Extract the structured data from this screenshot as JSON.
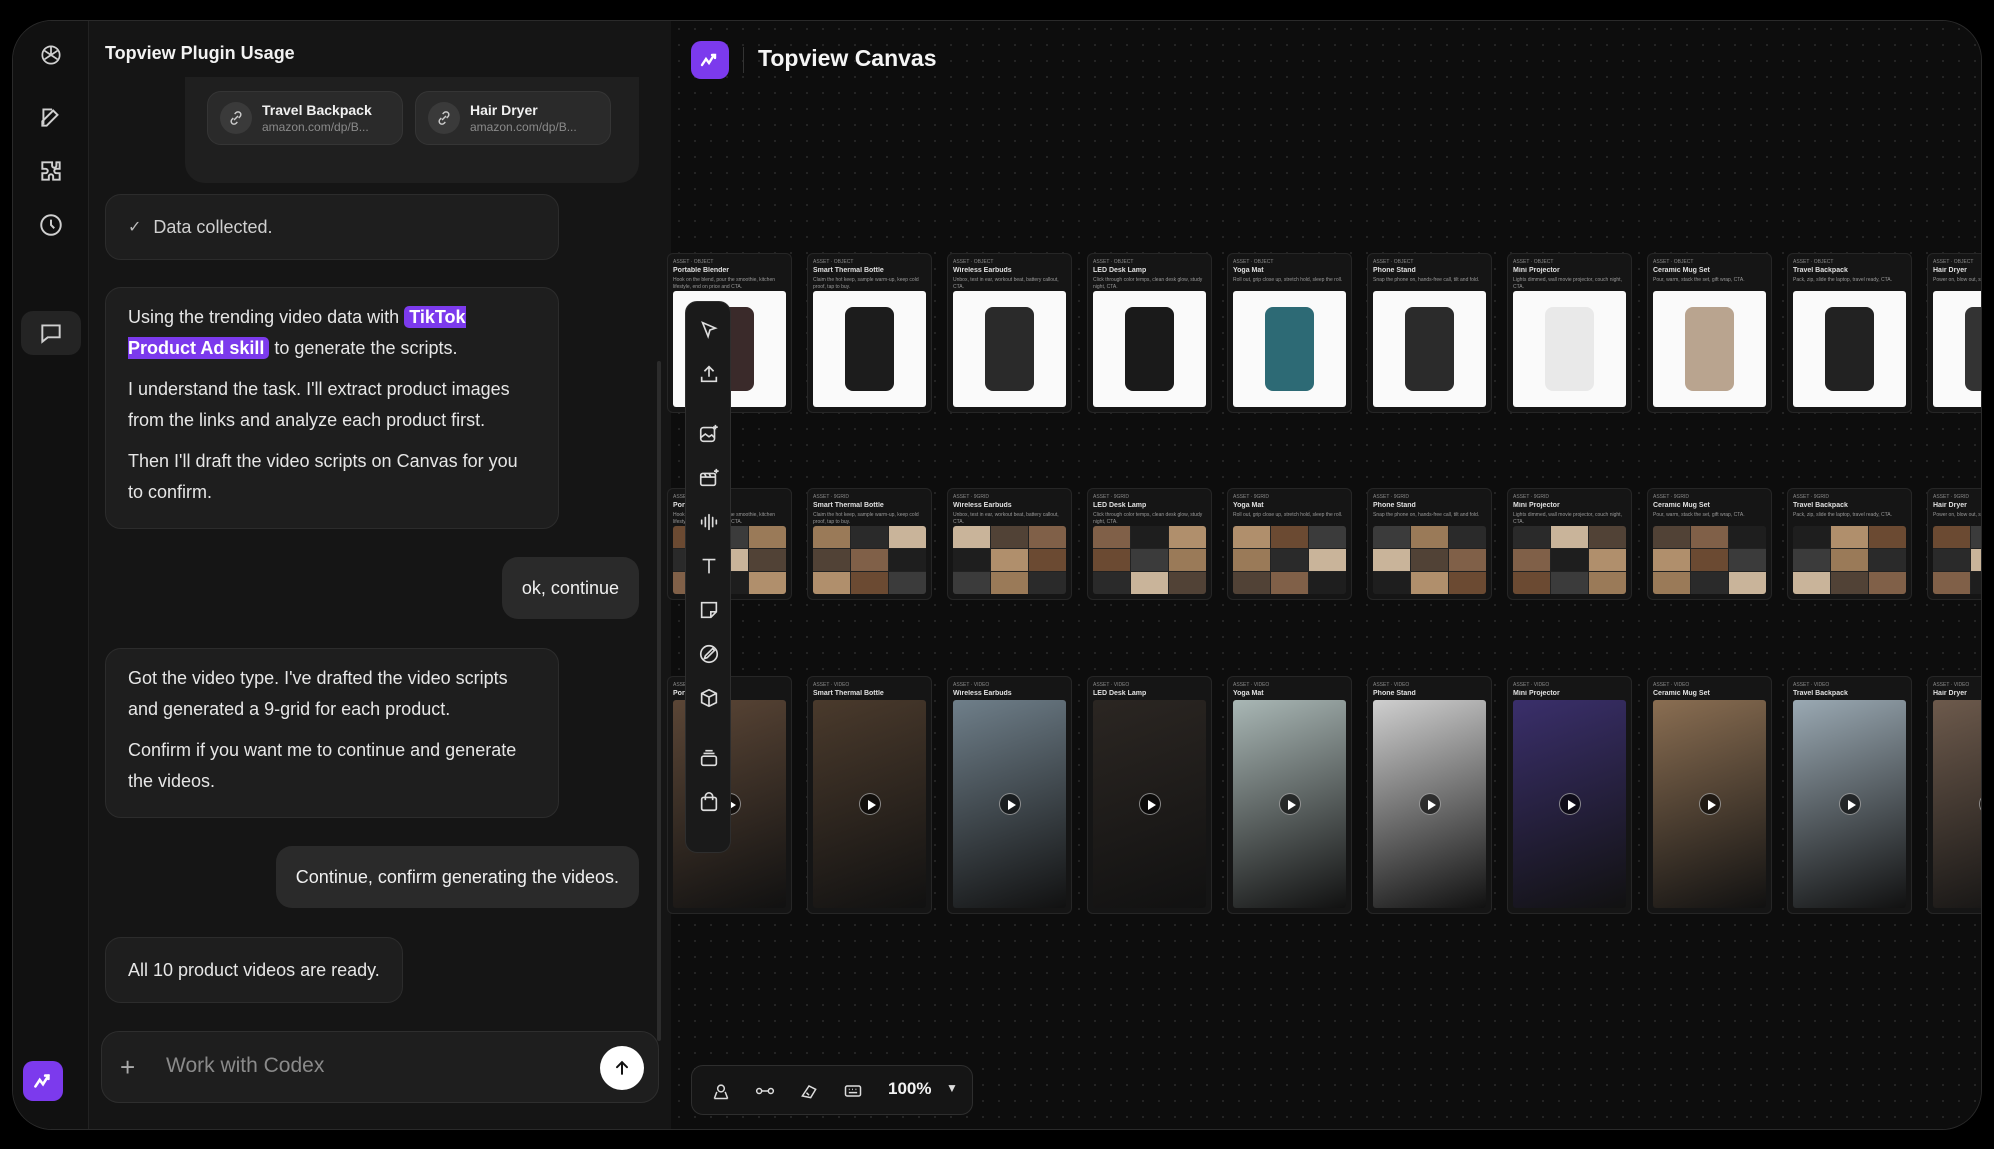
{
  "chat": {
    "title": "Topview Plugin Usage",
    "attachments": [
      {
        "name": "Travel Backpack",
        "url": "amazon.com/dp/B..."
      },
      {
        "name": "Hair Dryer",
        "url": "amazon.com/dp/B..."
      }
    ],
    "status": "Data collected.",
    "msg1": {
      "prefix": "Using the trending video data with",
      "skill": "TikTok Product Ad skill",
      "suffix": "to generate the scripts.",
      "p2": "I understand the task. I'll extract product images from the links and analyze each product first.",
      "p3": "Then I'll draft the video scripts on Canvas for you to confirm."
    },
    "user1": "ok, continue",
    "msg2": {
      "p1": "Got the video type. I've drafted the video scripts and generated a 9-grid for each product.",
      "p2": "Confirm if you want me to continue and generate the videos."
    },
    "user2": "Continue, confirm generating the videos.",
    "msg3": "All 10 product videos are ready.",
    "composer_placeholder": "Work with Codex"
  },
  "canvas": {
    "title": "Topview Canvas",
    "zoom": "100%",
    "products": [
      {
        "name": "Portable Blender",
        "desc": "Hook on the blend, pour the smoothie, kitchen lifestyle, end on price and CTA.",
        "color": "#3a2a2a"
      },
      {
        "name": "Smart Thermal Bottle",
        "desc": "Claim the hot keep, sample warm-up, keep cold proof, tap to buy.",
        "color": "#1c1c1c"
      },
      {
        "name": "Wireless Earbuds",
        "desc": "Unbox, test in ear, workout beat, battery callout, CTA.",
        "color": "#2a2a2a"
      },
      {
        "name": "LED Desk Lamp",
        "desc": "Click through color temps, clean desk glow, study night, CTA.",
        "color": "#1a1a1a"
      },
      {
        "name": "Yoga Mat",
        "desc": "Roll out, grip close up, stretch hold, sleep the roll.",
        "color": "#2d6a75"
      },
      {
        "name": "Phone Stand",
        "desc": "Snap the phone on, hands-free call, tilt and fold.",
        "color": "#2b2b2b"
      },
      {
        "name": "Mini Projector",
        "desc": "Lights dimmed, wall movie projector, couch night, CTA.",
        "color": "#e9e9e9"
      },
      {
        "name": "Ceramic Mug Set",
        "desc": "Pour, warm, stack the set, gift wrap, CTA.",
        "color": "#b9a48f"
      },
      {
        "name": "Travel Backpack",
        "desc": "Pack, zip, slide the laptop, travel ready, CTA.",
        "color": "#222"
      },
      {
        "name": "Hair Dryer",
        "desc": "Power on, blow out, shine finish, CTA.",
        "color": "#333"
      }
    ],
    "card_tag_image": "ASSET · OBJECT",
    "card_tag_grid": "ASSET · 9GRID",
    "card_tag_video": "ASSET · VIDEO"
  }
}
